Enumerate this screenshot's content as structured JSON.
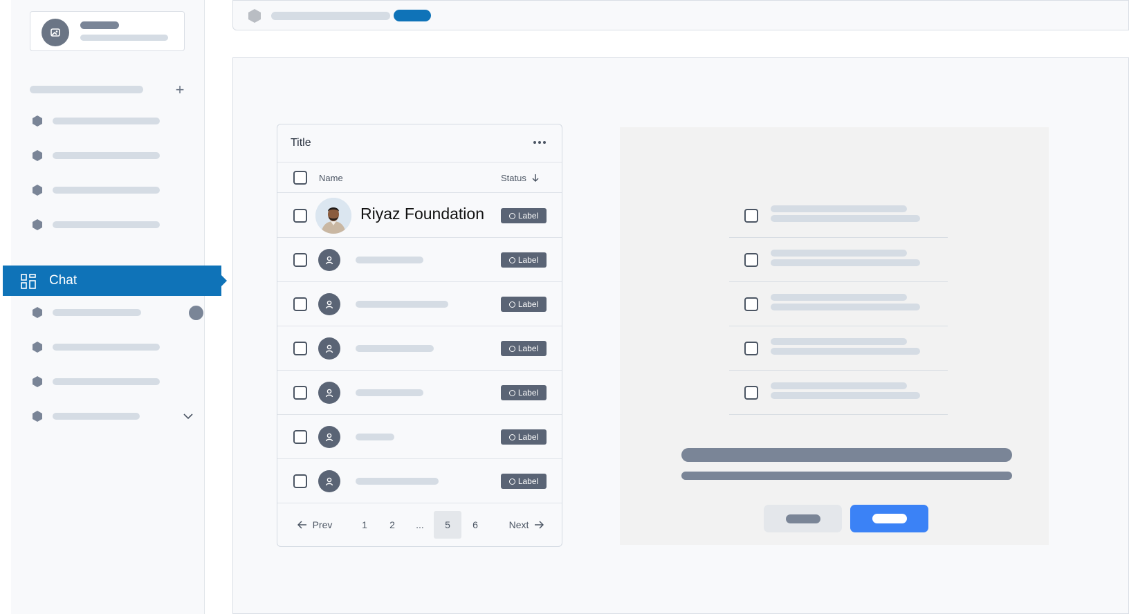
{
  "sidebar": {
    "active_item": {
      "label": "Chat",
      "icon": "grid-icon"
    },
    "colors": {
      "accent": "#0f73b8",
      "skeleton": "#d5dce4",
      "icon": "#7a8597"
    }
  },
  "table": {
    "title": "Title",
    "columns": {
      "name": "Name",
      "status": "Status"
    },
    "featured_row": {
      "name": "Riyaz Foundation",
      "status": "Label"
    },
    "rows": [
      {
        "status": "Label"
      },
      {
        "status": "Label"
      },
      {
        "status": "Label"
      },
      {
        "status": "Label"
      },
      {
        "status": "Label"
      },
      {
        "status": "Label"
      }
    ],
    "pagination": {
      "prev": "Prev",
      "next": "Next",
      "pages": [
        "1",
        "2",
        "...",
        "5",
        "6"
      ],
      "current": "5"
    }
  },
  "panel": {
    "primary_color": "#3b82f6"
  }
}
